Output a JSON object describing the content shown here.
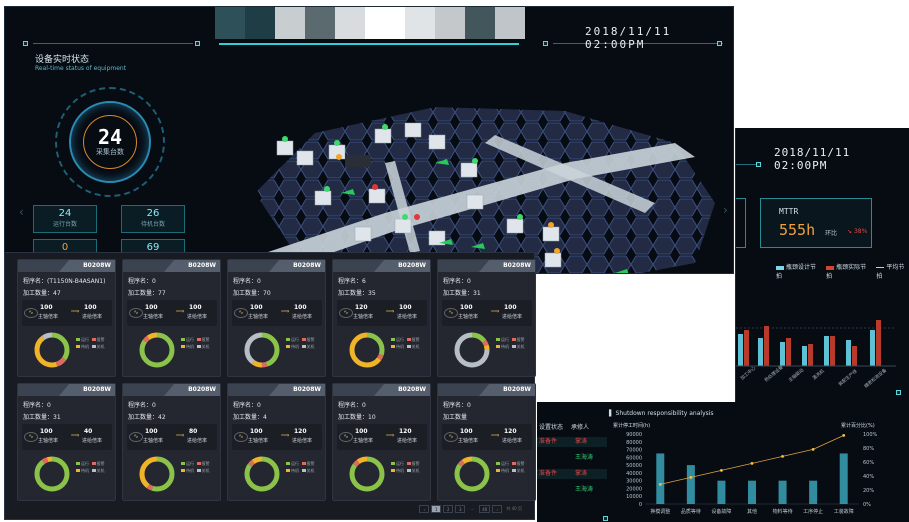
{
  "back_dashboard": {
    "datetime": "2018/11/11  02:00PM",
    "section": {
      "title": "设备实时状态",
      "subtitle": "Real-time status of equipment"
    },
    "total": {
      "value": "24",
      "label": "采集台数"
    },
    "stats": [
      {
        "value": "24",
        "label": "运行台数"
      },
      {
        "value": "26",
        "label": "待机台数"
      },
      {
        "value": "0",
        "label": ""
      },
      {
        "value": "69",
        "label": ""
      }
    ]
  },
  "right_dashboard": {
    "datetime": "2018/11/11  02:00PM",
    "mttr": {
      "label": "MTTR",
      "value": "555h",
      "compare_label": "环比",
      "compare_value": "38%"
    },
    "legend": [
      {
        "label": "瓶颈设计节拍",
        "color": "#7fd6e6"
      },
      {
        "label": "瓶颈实际节拍",
        "color": "#d2452f"
      },
      {
        "label": "平均节拍",
        "color": "#c9cfd6"
      }
    ],
    "bar_chart": {
      "categories": [
        "加工中心",
        "热处理设备",
        "主轴驱动",
        "清洗机",
        "装配生产线",
        "精密检测设备"
      ]
    }
  },
  "shutdown_panel": {
    "table_headers": [
      "设置状态",
      "承修人"
    ],
    "table_rows": [
      {
        "status": "准备件",
        "person": "掌涛"
      },
      {
        "status": "",
        "person": "王海涛"
      },
      {
        "status": "准备件",
        "person": "掌涛"
      },
      {
        "status": "",
        "person": "王海涛"
      }
    ],
    "title": "Shutdown responsibility analysis",
    "left_axis_label": "累计停工时间(h)",
    "right_axis_label": "累计百分比(%)"
  },
  "chart_data": {
    "type": "bar",
    "title": "Shutdown responsibility analysis",
    "ylabel": "累计停工时间(h)",
    "y2label": "累计百分比(%)",
    "categories": [
      "换模调整",
      "品质等待",
      "设备故障",
      "其他",
      "物料等待",
      "工序停止",
      "工装故障"
    ],
    "ylim": [
      0,
      90000
    ],
    "y2lim": [
      0,
      100
    ],
    "yticks": [
      "90000",
      "80000",
      "70000",
      "60000",
      "50000",
      "40000",
      "30000",
      "20000",
      "10000",
      "0"
    ],
    "y2ticks": [
      "100%",
      "80%",
      "60%",
      "40%",
      "20%",
      "0%"
    ],
    "series": [
      {
        "type": "bar",
        "values": [
          65000,
          50000,
          30000,
          30000,
          30000,
          30000,
          65000
        ]
      },
      {
        "type": "line",
        "values": [
          28,
          38,
          48,
          58,
          68,
          78,
          98
        ]
      }
    ]
  },
  "device_cards": [
    {
      "code": "B0208W",
      "program": "程序名：(T1150N-B4ASAN1)",
      "qty": "加工数量：47",
      "rate1": "100",
      "rate1_label": "主轴倍率",
      "rate2": "100",
      "rate2_label": "进给倍率"
    },
    {
      "code": "B0208W",
      "program": "程序名：0",
      "qty": "加工数量：77",
      "rate1": "100",
      "rate1_label": "主轴倍率",
      "rate2": "100",
      "rate2_label": "进给倍率"
    },
    {
      "code": "B0208W",
      "program": "程序名：0",
      "qty": "加工数量：70",
      "rate1": "100",
      "rate1_label": "主轴倍率",
      "rate2": "100",
      "rate2_label": "进给倍率"
    },
    {
      "code": "B0208W",
      "program": "程序名：6",
      "qty": "加工数量：35",
      "rate1": "120",
      "rate1_label": "主轴倍率",
      "rate2": "100",
      "rate2_label": "进给倍率"
    },
    {
      "code": "B0208W",
      "program": "程序名：0",
      "qty": "加工数量：31",
      "rate1": "100",
      "rate1_label": "主轴倍率",
      "rate2": "100",
      "rate2_label": "进给倍率"
    },
    {
      "code": "B0208W",
      "program": "程序名：0",
      "qty": "加工数量：31",
      "rate1": "100",
      "rate1_label": "主轴倍率",
      "rate2": "40",
      "rate2_label": "进给倍率"
    },
    {
      "code": "B0208W",
      "program": "程序名：0",
      "qty": "加工数量：42",
      "rate1": "100",
      "rate1_label": "主轴倍率",
      "rate2": "80",
      "rate2_label": "进给倍率"
    },
    {
      "code": "B0208W",
      "program": "程序名：0",
      "qty": "加工数量：4",
      "rate1": "100",
      "rate1_label": "主轴倍率",
      "rate2": "120",
      "rate2_label": "进给倍率"
    },
    {
      "code": "B0208W",
      "program": "程序名：0",
      "qty": "加工数量：10",
      "rate1": "100",
      "rate1_label": "主轴倍率",
      "rate2": "120",
      "rate2_label": "进给倍率"
    },
    {
      "code": "B0208W",
      "program": "程序名：0",
      "qty": "加工数量",
      "rate1": "100",
      "rate1_label": "主轴倍率",
      "rate2": "120",
      "rate2_label": "进给倍率"
    }
  ],
  "card_legend": {
    "run": "运行",
    "alarm": "报警",
    "standby": "待机",
    "off": "关机"
  },
  "colors": {
    "run": "#8bc34a",
    "alarm": "#e06b5c",
    "standby": "#f0b429",
    "off": "#b8bec6",
    "accent": "#2fd0d8"
  },
  "pager": {
    "pages": [
      "1",
      "2",
      "3",
      "...",
      "40"
    ],
    "active": "1",
    "info": "共 40 页"
  }
}
